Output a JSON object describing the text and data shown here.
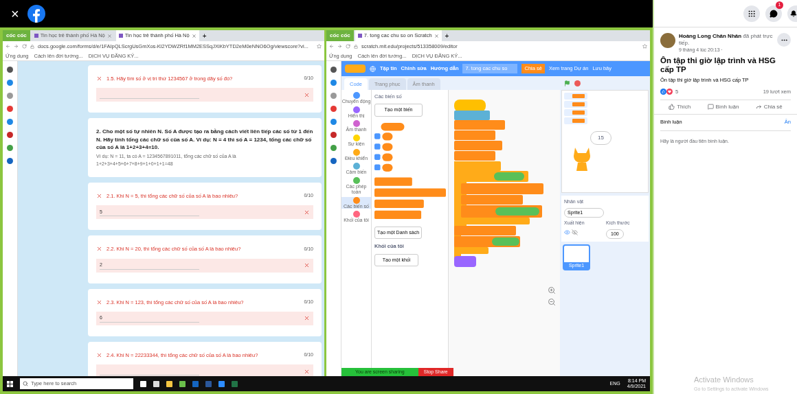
{
  "viewer": {
    "close": "×"
  },
  "left_browser": {
    "brand": "cốc cốc",
    "tabs": [
      {
        "title": "Tin học trẻ thành phố Hà Nộ",
        "selected": false
      },
      {
        "title": "Tin học trẻ thành phố Hà Nộ",
        "selected": true
      }
    ],
    "new_tab": "+",
    "url": "docs.google.com/forms/d/e/1FAIpQLScrgUsGmXos-Kl2YDWZRf1MM2ESSqJXiKbYTD2eM0eNNO6Og/viewscore?vi...",
    "bookmarks": [
      "Ứng dụng",
      "Cách lên đời tướng...",
      "DỊCH VỤ ĐĂNG KÝ..."
    ],
    "form_items": [
      {
        "kind": "question",
        "title": "1.5. Hãy tìm số ở vị trí thứ 1234567 ở trong dãy số đó?",
        "score": "0/10"
      },
      {
        "kind": "section",
        "title": "2. Cho một số tự nhiên N. Số A được tạo ra bằng cách viết liên tiếp các số từ 1 đến N. Hãy tính tổng các chữ số của số A. Ví dụ: N = 4 thì số A = 1234, tổng các chữ số của số A là 1+2+3+4=10.",
        "note": "Ví dụ: N = 11, ta có A = 1234567891011, tổng các chữ số của A là 1+2+3+4+5+6+7+8+9+1+0+1+1=48"
      },
      {
        "kind": "question",
        "title": "2.1. Khi N = 5, thì tổng các chữ số của số A là bao nhiêu?",
        "score": "0/10",
        "answer": "5"
      },
      {
        "kind": "question",
        "title": "2.2. Khi N = 20, thì tổng các chữ số của số A là bao nhiêu?",
        "score": "0/10",
        "answer": "2"
      },
      {
        "kind": "question",
        "title": "2.3. Khi N = 123, thì tổng các chữ số của số A là bao nhiêu?",
        "score": "0/10",
        "answer": "6"
      },
      {
        "kind": "question",
        "title": "2.4. Khi N = 22233344, thì tổng các chữ số của số A là bao nhiêu?",
        "score": "0/10"
      }
    ]
  },
  "right_browser": {
    "brand": "cốc cốc",
    "tabs": [
      {
        "title": "7. tong cac chu so on Scratch",
        "selected": true
      }
    ],
    "new_tab": "+",
    "url": "scratch.mit.edu/projects/513358009/editor",
    "bookmarks": [
      "Ứng dụng",
      "Cách lên đời tướng...",
      "DỊCH VỤ ĐĂNG KÝ..."
    ],
    "menu": [
      "Tập tin",
      "Chỉnh sửa",
      "Hướng dẫn"
    ],
    "project_title": "7. tong cac chu so",
    "share": "Chia sẻ",
    "see_project": "Xem trang Dự án",
    "save": "Lưu bây",
    "editor_tabs": [
      {
        "label": "Code",
        "selected": true
      },
      {
        "label": "Trang phục",
        "selected": false
      },
      {
        "label": "Âm thanh",
        "selected": false
      }
    ],
    "categories": [
      {
        "label": "Chuyển động",
        "color": "#4c97ff",
        "selected": false
      },
      {
        "label": "Hiển thị",
        "color": "#9966ff",
        "selected": false
      },
      {
        "label": "Âm thanh",
        "color": "#cf63cf",
        "selected": false
      },
      {
        "label": "Sự kiện",
        "color": "#ffd500",
        "selected": false
      },
      {
        "label": "Điều khiển",
        "color": "#ffab19",
        "selected": false
      },
      {
        "label": "Cảm biến",
        "color": "#5cb1d6",
        "selected": false
      },
      {
        "label": "Các phép toán",
        "color": "#59c059",
        "selected": false
      },
      {
        "label": "Các biến số",
        "color": "#ff8c1a",
        "selected": true
      },
      {
        "label": "Khối của tôi",
        "color": "#ff6680",
        "selected": false
      }
    ],
    "palette_heading": "Các biến số",
    "make_variable": "Tạo một biến",
    "make_list": "Tạo một Danh sách",
    "my_blocks_heading": "Khối của tôi",
    "make_block": "Tạo một khối",
    "speech": "15",
    "sprite_label": "Nhân vật",
    "sprite_name": "Sprite1",
    "show_label": "Xuất hiện",
    "size_label": "Kích thước",
    "size": "100",
    "sprite_tile": "Sprite1",
    "sharing": "You are screen sharing",
    "stop_share": "Stop Share"
  },
  "taskbar": {
    "search_placeholder": "Type here to search",
    "language": "ENG",
    "time": "8:14 PM",
    "date": "4/9/2021"
  },
  "post": {
    "messenger_badge": "1",
    "author": "Hoàng Long Chân Nhân",
    "action": "đã phát trực tiếp.",
    "time": "9 tháng 4 lúc 20:13 ·",
    "title": "Ôn tập thi giờ lập trình và HSG cấp TP",
    "description": "Ôn tập thi giờ lập trình và HSG cấp TP",
    "reactions": "5",
    "views": "19 lượt xem",
    "actions": [
      "Thích",
      "Bình luận",
      "Chia sẻ"
    ],
    "comments_label": "Bình luận",
    "hide": "Ẩn",
    "empty": "Hãy là người đầu tiên bình luận."
  },
  "os_notice": {
    "title": "Activate Windows",
    "text": "Go to Settings to activate Windows"
  }
}
